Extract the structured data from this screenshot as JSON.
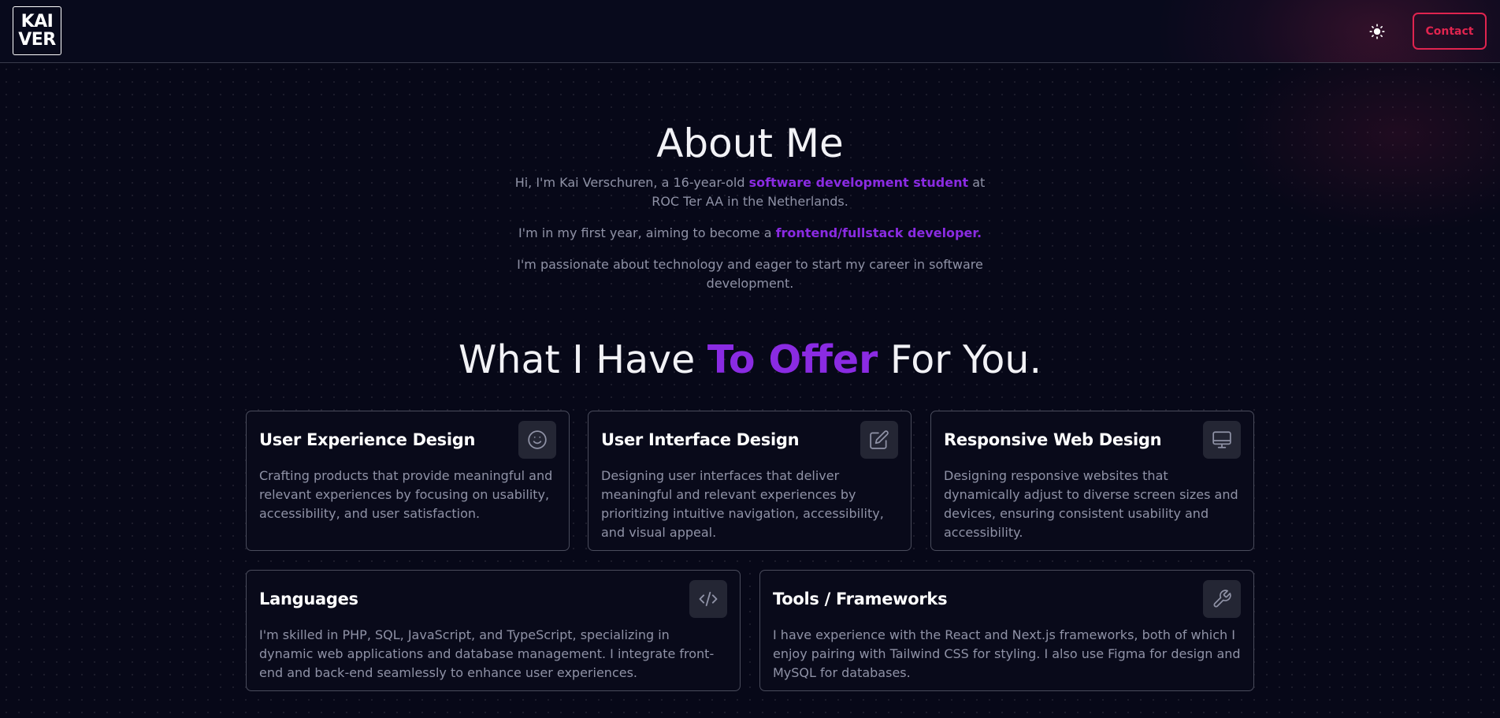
{
  "header": {
    "logo_line1": "KAI",
    "logo_line2": "VER",
    "theme_icon": "sun-icon",
    "contact_label": "Contact"
  },
  "about": {
    "title": "About Me",
    "p1_before": "Hi, I'm Kai Verschuren, a 16-year-old ",
    "p1_highlight": "software development student",
    "p1_after": " at ROC Ter AA in the Netherlands.",
    "p2_before": "I'm in my first year, aiming to become a ",
    "p2_highlight": "frontend/fullstack developer.",
    "p3": "I'm passionate about technology and eager to start my career in software development."
  },
  "offer": {
    "title_before": "What I Have ",
    "title_highlight": "To Offer",
    "title_after": " For You.",
    "cards": [
      {
        "title": "User Experience Design",
        "text": "Crafting products that provide meaningful and relevant experiences by focusing on usability, accessibility, and user satisfaction.",
        "icon": "smile-icon"
      },
      {
        "title": "User Interface Design",
        "text": "Designing user interfaces that deliver meaningful and relevant experiences by prioritizing intuitive navigation, accessibility, and visual appeal.",
        "icon": "edit-icon"
      },
      {
        "title": "Responsive Web Design",
        "text": "Designing responsive websites that dynamically adjust to diverse screen sizes and devices, ensuring consistent usability and accessibility.",
        "icon": "monitor-icon"
      },
      {
        "title": "Languages",
        "text": "I'm skilled in PHP, SQL, JavaScript, and TypeScript, specializing in dynamic web applications and database management. I integrate front-end and back-end seamlessly to enhance user experiences.",
        "icon": "code-icon"
      },
      {
        "title": "Tools / Frameworks",
        "text": "I have experience with the React and Next.js frameworks, both of which I enjoy pairing with Tailwind CSS for styling. I also use Figma for design and MySQL for databases.",
        "icon": "wrench-icon"
      }
    ]
  },
  "colors": {
    "background": "#070818",
    "accent_purple": "#8a2be2",
    "contact_red": "#e0244f",
    "muted_text": "#8f92a6"
  }
}
